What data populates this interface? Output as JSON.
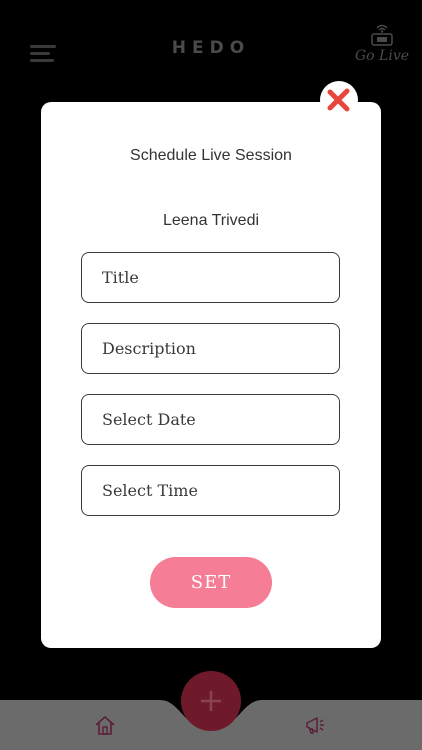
{
  "header": {
    "logo_text": "HEDO",
    "go_live_label": "Go Live",
    "icons": {
      "menu": "menu-icon",
      "go_live": "broadcast-icon"
    }
  },
  "modal": {
    "title": "Schedule Live Session",
    "user_name": "Leena Trivedi",
    "fields": {
      "title_placeholder": "Title",
      "description_placeholder": "Description",
      "date_placeholder": "Select Date",
      "time_placeholder": "Select Time"
    },
    "set_label": "SET",
    "close_icon": "close-icon"
  },
  "bottom_nav": {
    "add_icon": "plus-icon",
    "home_icon": "home-icon",
    "announce_icon": "megaphone-icon"
  },
  "colors": {
    "background": "#000000",
    "modal_bg": "#ffffff",
    "accent_pink": "#f57d95",
    "close_red": "#e8453c",
    "fab_dark": "#6e1a2a",
    "nav_bar": "#6b6b6b"
  }
}
